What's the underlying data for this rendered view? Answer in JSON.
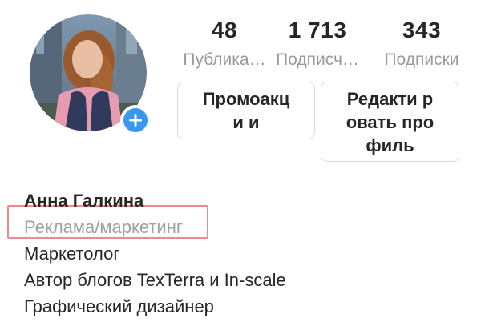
{
  "profile": {
    "stats": [
      {
        "count": "48",
        "label": "Публика…"
      },
      {
        "count": "1 713",
        "label": "Подписч…"
      },
      {
        "count": "343",
        "label": "Подписки"
      }
    ],
    "buttons": {
      "promo": "Промоакци и",
      "edit": "Редакти ровать профиль"
    },
    "bio": {
      "name": "Анна Галкина",
      "category": "Реклама/маркетинг",
      "lines": [
        "Маркетолог",
        "Автор блогов TexTerra и In-scale",
        "Графический дизайнер"
      ]
    }
  },
  "colors": {
    "accent": "#3897f0",
    "highlight": "#f08a8a",
    "muted_text": "#999999",
    "border": "#dbdbdb"
  },
  "icons": {
    "avatar": "avatar-photo",
    "add_story": "plus-icon"
  }
}
